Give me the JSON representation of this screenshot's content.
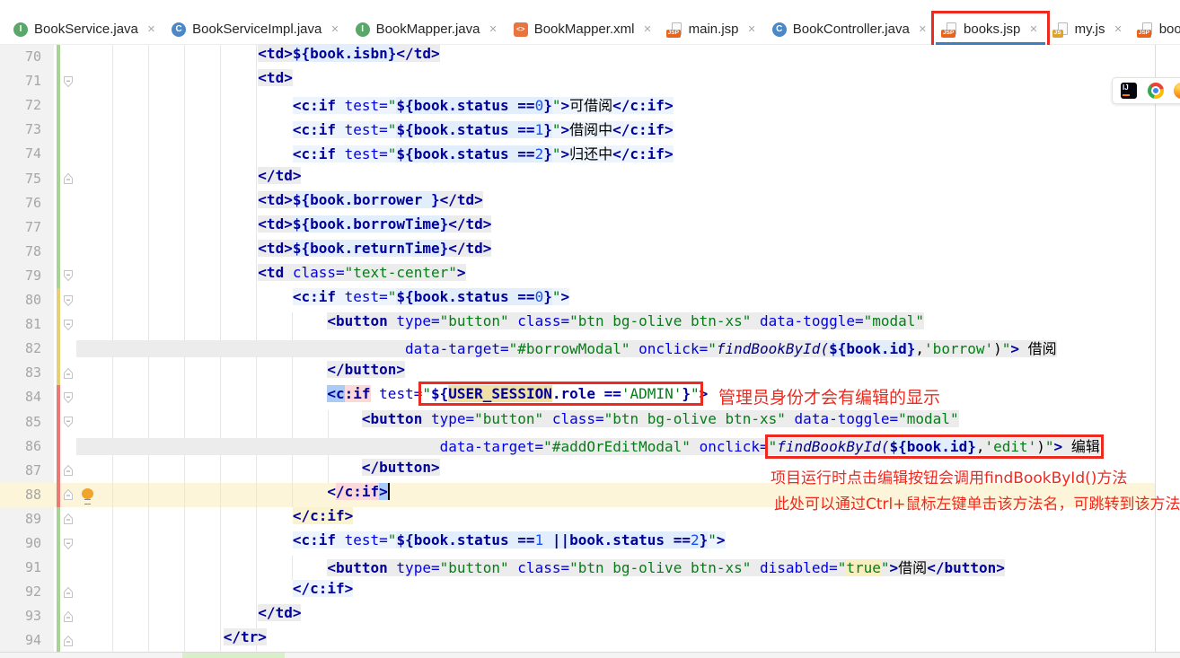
{
  "tabs": [
    {
      "icon": "interface",
      "label": "BookService.java",
      "selected": false,
      "annotated": false
    },
    {
      "icon": "class",
      "label": "BookServiceImpl.java",
      "selected": false,
      "annotated": false
    },
    {
      "icon": "interface",
      "label": "BookMapper.java",
      "selected": false,
      "annotated": false
    },
    {
      "icon": "xml",
      "label": "BookMapper.xml",
      "selected": false,
      "annotated": false
    },
    {
      "icon": "jsp",
      "label": "main.jsp",
      "selected": false,
      "annotated": false
    },
    {
      "icon": "class",
      "label": "BookController.java",
      "selected": false,
      "annotated": false
    },
    {
      "icon": "jsp",
      "label": "books.jsp",
      "selected": true,
      "annotated": true
    },
    {
      "icon": "js",
      "label": "my.js",
      "selected": false,
      "annotated": false
    },
    {
      "icon": "jsp",
      "label": "book_modal.jsp",
      "selected": false,
      "annotated": false
    }
  ],
  "tab_close_glyph": "✕",
  "annotations": {
    "admin_note": "管理员身份才会有编辑的显示",
    "note_line1": "项目运行时点击编辑按钮会调用findBookById()方法",
    "note_line2": "此处可以通过Ctrl+鼠标左键单击该方法名，可跳转到该方法",
    "color": "#ee2a1e"
  },
  "browser_toolbar": {
    "icons": [
      "intellij",
      "chrome",
      "firefox"
    ]
  },
  "editor": {
    "first_line": 70,
    "caret_line": 88,
    "vcs_bars": [
      {
        "from": 70,
        "to": 79,
        "color": "#a9d396"
      },
      {
        "from": 80,
        "to": 83,
        "color": "#e7cf76"
      },
      {
        "from": 84,
        "to": 88,
        "color": "#ea7a76"
      },
      {
        "from": 89,
        "to": 94,
        "color": "#a9d396"
      }
    ],
    "lines": [
      {
        "n": 70,
        "ind": 21,
        "segs": [
          {
            "t": "<td>",
            "c": "tag bgt"
          },
          {
            "t": "${book.isbn}",
            "c": "el bge"
          },
          {
            "t": "</td>",
            "c": "tag bgt"
          }
        ]
      },
      {
        "n": 71,
        "ind": 21,
        "fold": "d",
        "segs": [
          {
            "t": "<td>",
            "c": "tag bgt"
          }
        ]
      },
      {
        "n": 72,
        "ind": 25,
        "segs": [
          {
            "t": "<c:if ",
            "c": "tag bgb"
          },
          {
            "t": "test=",
            "c": "attr bgb"
          },
          {
            "t": "\"",
            "c": "str bgb"
          },
          {
            "t": "${book.status ==",
            "c": "el bgb2"
          },
          {
            "t": "0",
            "c": "num bgb2"
          },
          {
            "t": "}",
            "c": "el bgb2"
          },
          {
            "t": "\"",
            "c": "str bgb"
          },
          {
            "t": ">",
            "c": "tag bgb"
          },
          {
            "t": "可借阅",
            "c": "cn bgb"
          },
          {
            "t": "</c:if>",
            "c": "tag bgb"
          }
        ]
      },
      {
        "n": 73,
        "ind": 25,
        "segs": [
          {
            "t": "<c:if ",
            "c": "tag bgb"
          },
          {
            "t": "test=",
            "c": "attr bgb"
          },
          {
            "t": "\"",
            "c": "str bgb"
          },
          {
            "t": "${book.status ==",
            "c": "el bgb2"
          },
          {
            "t": "1",
            "c": "num bgb2"
          },
          {
            "t": "}",
            "c": "el bgb2"
          },
          {
            "t": "\"",
            "c": "str bgb"
          },
          {
            "t": ">",
            "c": "tag bgb"
          },
          {
            "t": "借阅中",
            "c": "cn bgb"
          },
          {
            "t": "</c:if>",
            "c": "tag bgb"
          }
        ]
      },
      {
        "n": 74,
        "ind": 25,
        "segs": [
          {
            "t": "<c:if ",
            "c": "tag bgb"
          },
          {
            "t": "test=",
            "c": "attr bgb"
          },
          {
            "t": "\"",
            "c": "str bgb"
          },
          {
            "t": "${book.status ==",
            "c": "el bgb2"
          },
          {
            "t": "2",
            "c": "num bgb2"
          },
          {
            "t": "}",
            "c": "el bgb2"
          },
          {
            "t": "\"",
            "c": "str bgb"
          },
          {
            "t": ">",
            "c": "tag bgb"
          },
          {
            "t": "归还中",
            "c": "cn bgb"
          },
          {
            "t": "</c:if>",
            "c": "tag bgb"
          }
        ]
      },
      {
        "n": 75,
        "ind": 21,
        "fold": "u",
        "segs": [
          {
            "t": "</td>",
            "c": "tag bgt"
          }
        ]
      },
      {
        "n": 76,
        "ind": 21,
        "segs": [
          {
            "t": "<td>",
            "c": "tag bgt"
          },
          {
            "t": "${book.borrower }",
            "c": "el bge"
          },
          {
            "t": "</td>",
            "c": "tag bgt"
          }
        ]
      },
      {
        "n": 77,
        "ind": 21,
        "segs": [
          {
            "t": "<td>",
            "c": "tag bgt"
          },
          {
            "t": "${book.borrowTime}",
            "c": "el bge"
          },
          {
            "t": "</td>",
            "c": "tag bgt"
          }
        ]
      },
      {
        "n": 78,
        "ind": 21,
        "segs": [
          {
            "t": "<td>",
            "c": "tag bgt"
          },
          {
            "t": "${book.returnTime}",
            "c": "el bge"
          },
          {
            "t": "</td>",
            "c": "tag bgt"
          }
        ]
      },
      {
        "n": 79,
        "ind": 21,
        "fold": "d",
        "segs": [
          {
            "t": "<td ",
            "c": "tag bgt"
          },
          {
            "t": "class=",
            "c": "attr bgt"
          },
          {
            "t": "\"text-center\"",
            "c": "str bgt"
          },
          {
            "t": ">",
            "c": "tag bgt"
          }
        ]
      },
      {
        "n": 80,
        "ind": 25,
        "fold": "d",
        "segs": [
          {
            "t": "<c:if ",
            "c": "tag bgb"
          },
          {
            "t": "test=",
            "c": "attr bgb"
          },
          {
            "t": "\"",
            "c": "str bgb"
          },
          {
            "t": "${book.status ==",
            "c": "el bgb2"
          },
          {
            "t": "0",
            "c": "num bgb2"
          },
          {
            "t": "}",
            "c": "el bgb2"
          },
          {
            "t": "\"",
            "c": "str bgb"
          },
          {
            "t": ">",
            "c": "tag bgb"
          }
        ]
      },
      {
        "n": 81,
        "ind": 29,
        "fold": "d",
        "segs": [
          {
            "t": "<button ",
            "c": "tag bgt"
          },
          {
            "t": "type=",
            "c": "attr bgt"
          },
          {
            "t": "\"button\" ",
            "c": "str bgt"
          },
          {
            "t": "class=",
            "c": "attr bgt"
          },
          {
            "t": "\"btn bg-olive btn-xs\" ",
            "c": "str bgt"
          },
          {
            "t": "data-toggle=",
            "c": "attr bgt"
          },
          {
            "t": "\"modal\"",
            "c": "str bgt"
          }
        ]
      },
      {
        "n": 82,
        "ind": 38,
        "band": "bgt",
        "segs": [
          {
            "t": "data-target=",
            "c": "attr bgt"
          },
          {
            "t": "\"#borrowModal\" ",
            "c": "str bgt"
          },
          {
            "t": "onclick=",
            "c": "attr bgt"
          },
          {
            "t": "\"",
            "c": "str bgt"
          },
          {
            "t": "findBookById(",
            "c": "js bgt"
          },
          {
            "t": "${book.id}",
            "c": "el bge"
          },
          {
            "t": ",",
            "c": "pln bgt"
          },
          {
            "t": "'borrow'",
            "c": "str bgt"
          },
          {
            "t": ")",
            "c": "pln bgt"
          },
          {
            "t": "\"",
            "c": "str bgt"
          },
          {
            "t": "> ",
            "c": "tag bgt"
          },
          {
            "t": "借阅",
            "c": "cn bgt"
          }
        ]
      },
      {
        "n": 83,
        "ind": 29,
        "fold": "u",
        "segs": [
          {
            "t": "</button>",
            "c": "tag bgt"
          }
        ]
      },
      {
        "n": 84,
        "ind": 29,
        "fold": "d",
        "segs": [
          {
            "t": "<c",
            "c": "tag bgsel"
          },
          {
            "t": ":if",
            "c": "tag bgpink"
          },
          {
            "t": " ",
            "c": "pln"
          },
          {
            "t": "test=",
            "c": "attr"
          },
          {
            "box": [
              {
                "t": "\"",
                "c": "str"
              },
              {
                "t": "${",
                "c": "el"
              },
              {
                "t": "USER_SESSION",
                "c": "el bgtan"
              },
              {
                "t": ".role ==",
                "c": "el"
              },
              {
                "t": "'ADMIN'",
                "c": "str"
              },
              {
                "t": "}",
                "c": "el"
              },
              {
                "t": "\"",
                "c": "str"
              }
            ]
          },
          {
            "t": ">",
            "c": "tag"
          }
        ]
      },
      {
        "n": 85,
        "ind": 33,
        "fold": "d",
        "segs": [
          {
            "t": "<button ",
            "c": "tag bgt"
          },
          {
            "t": "type=",
            "c": "attr bgt"
          },
          {
            "t": "\"button\" ",
            "c": "str bgt"
          },
          {
            "t": "class=",
            "c": "attr bgt"
          },
          {
            "t": "\"btn bg-olive btn-xs\" ",
            "c": "str bgt"
          },
          {
            "t": "data-toggle=",
            "c": "attr bgt"
          },
          {
            "t": "\"modal\"",
            "c": "str bgt"
          }
        ]
      },
      {
        "n": 86,
        "ind": 42,
        "band": "bgt",
        "segs": [
          {
            "t": "data-target=",
            "c": "attr bgt"
          },
          {
            "t": "\"#addOrEditModal\" ",
            "c": "str bgt"
          },
          {
            "t": "onclick=",
            "c": "attr bgt"
          },
          {
            "box": [
              {
                "t": "\"",
                "c": "str bgt"
              },
              {
                "t": "findBookById(",
                "c": "js bgt"
              },
              {
                "t": "${book.id}",
                "c": "el bge"
              },
              {
                "t": ",",
                "c": "pln bgt"
              },
              {
                "t": "'edit'",
                "c": "str bgt"
              },
              {
                "t": ")",
                "c": "pln bgt"
              },
              {
                "t": "\"",
                "c": "str bgt"
              },
              {
                "t": "> ",
                "c": "tag bgt"
              },
              {
                "t": "编辑",
                "c": "cn bgt"
              }
            ]
          }
        ]
      },
      {
        "n": 87,
        "ind": 33,
        "fold": "u",
        "segs": [
          {
            "t": "</button>",
            "c": "tag bgt"
          }
        ]
      },
      {
        "n": 88,
        "ind": 29,
        "fold": "u",
        "bulb": true,
        "caret": true,
        "caretline": true,
        "segs": [
          {
            "t": "<",
            "c": "tag"
          },
          {
            "t": "/c:if",
            "c": "tag bgpink"
          },
          {
            "t": ">",
            "c": "tag bgsel"
          }
        ]
      },
      {
        "n": 89,
        "ind": 25,
        "fold": "u",
        "segs": [
          {
            "t": "</c:if>",
            "c": "tag bgyel"
          }
        ]
      },
      {
        "n": 90,
        "ind": 25,
        "fold": "d",
        "segs": [
          {
            "t": "<c:if ",
            "c": "tag bgb"
          },
          {
            "t": "test=",
            "c": "attr bgb"
          },
          {
            "t": "\"",
            "c": "str bgb"
          },
          {
            "t": "${book.status ==",
            "c": "el bgb2"
          },
          {
            "t": "1",
            "c": "num bgb2"
          },
          {
            "t": " ||book.status ==",
            "c": "el bgb2"
          },
          {
            "t": "2",
            "c": "num bgb2"
          },
          {
            "t": "}",
            "c": "el bgb2"
          },
          {
            "t": "\"",
            "c": "str bgb"
          },
          {
            "t": ">",
            "c": "tag bgb"
          }
        ]
      },
      {
        "n": 91,
        "ind": 29,
        "segs": [
          {
            "t": "<button ",
            "c": "tag bgt"
          },
          {
            "t": "type=",
            "c": "attr bgt"
          },
          {
            "t": "\"button\" ",
            "c": "str bgt"
          },
          {
            "t": "class=",
            "c": "attr bgt"
          },
          {
            "t": "\"btn bg-olive btn-xs\" ",
            "c": "str bgt"
          },
          {
            "t": "disabled=",
            "c": "attr bgt"
          },
          {
            "t": "\"",
            "c": "str bgt"
          },
          {
            "t": "true",
            "c": "str bgwarn"
          },
          {
            "t": "\"",
            "c": "str bgt"
          },
          {
            "t": ">",
            "c": "tag bgt"
          },
          {
            "t": "借阅",
            "c": "cn bgt"
          },
          {
            "t": "</button>",
            "c": "tag bgt"
          }
        ]
      },
      {
        "n": 92,
        "ind": 25,
        "fold": "u",
        "segs": [
          {
            "t": "</c:if>",
            "c": "tag bgb"
          }
        ]
      },
      {
        "n": 93,
        "ind": 21,
        "fold": "u",
        "segs": [
          {
            "t": "</td>",
            "c": "tag bgt"
          }
        ]
      },
      {
        "n": 94,
        "ind": 17,
        "fold": "u",
        "segs": [
          {
            "t": "</tr>",
            "c": "tag bgt"
          }
        ]
      }
    ]
  }
}
